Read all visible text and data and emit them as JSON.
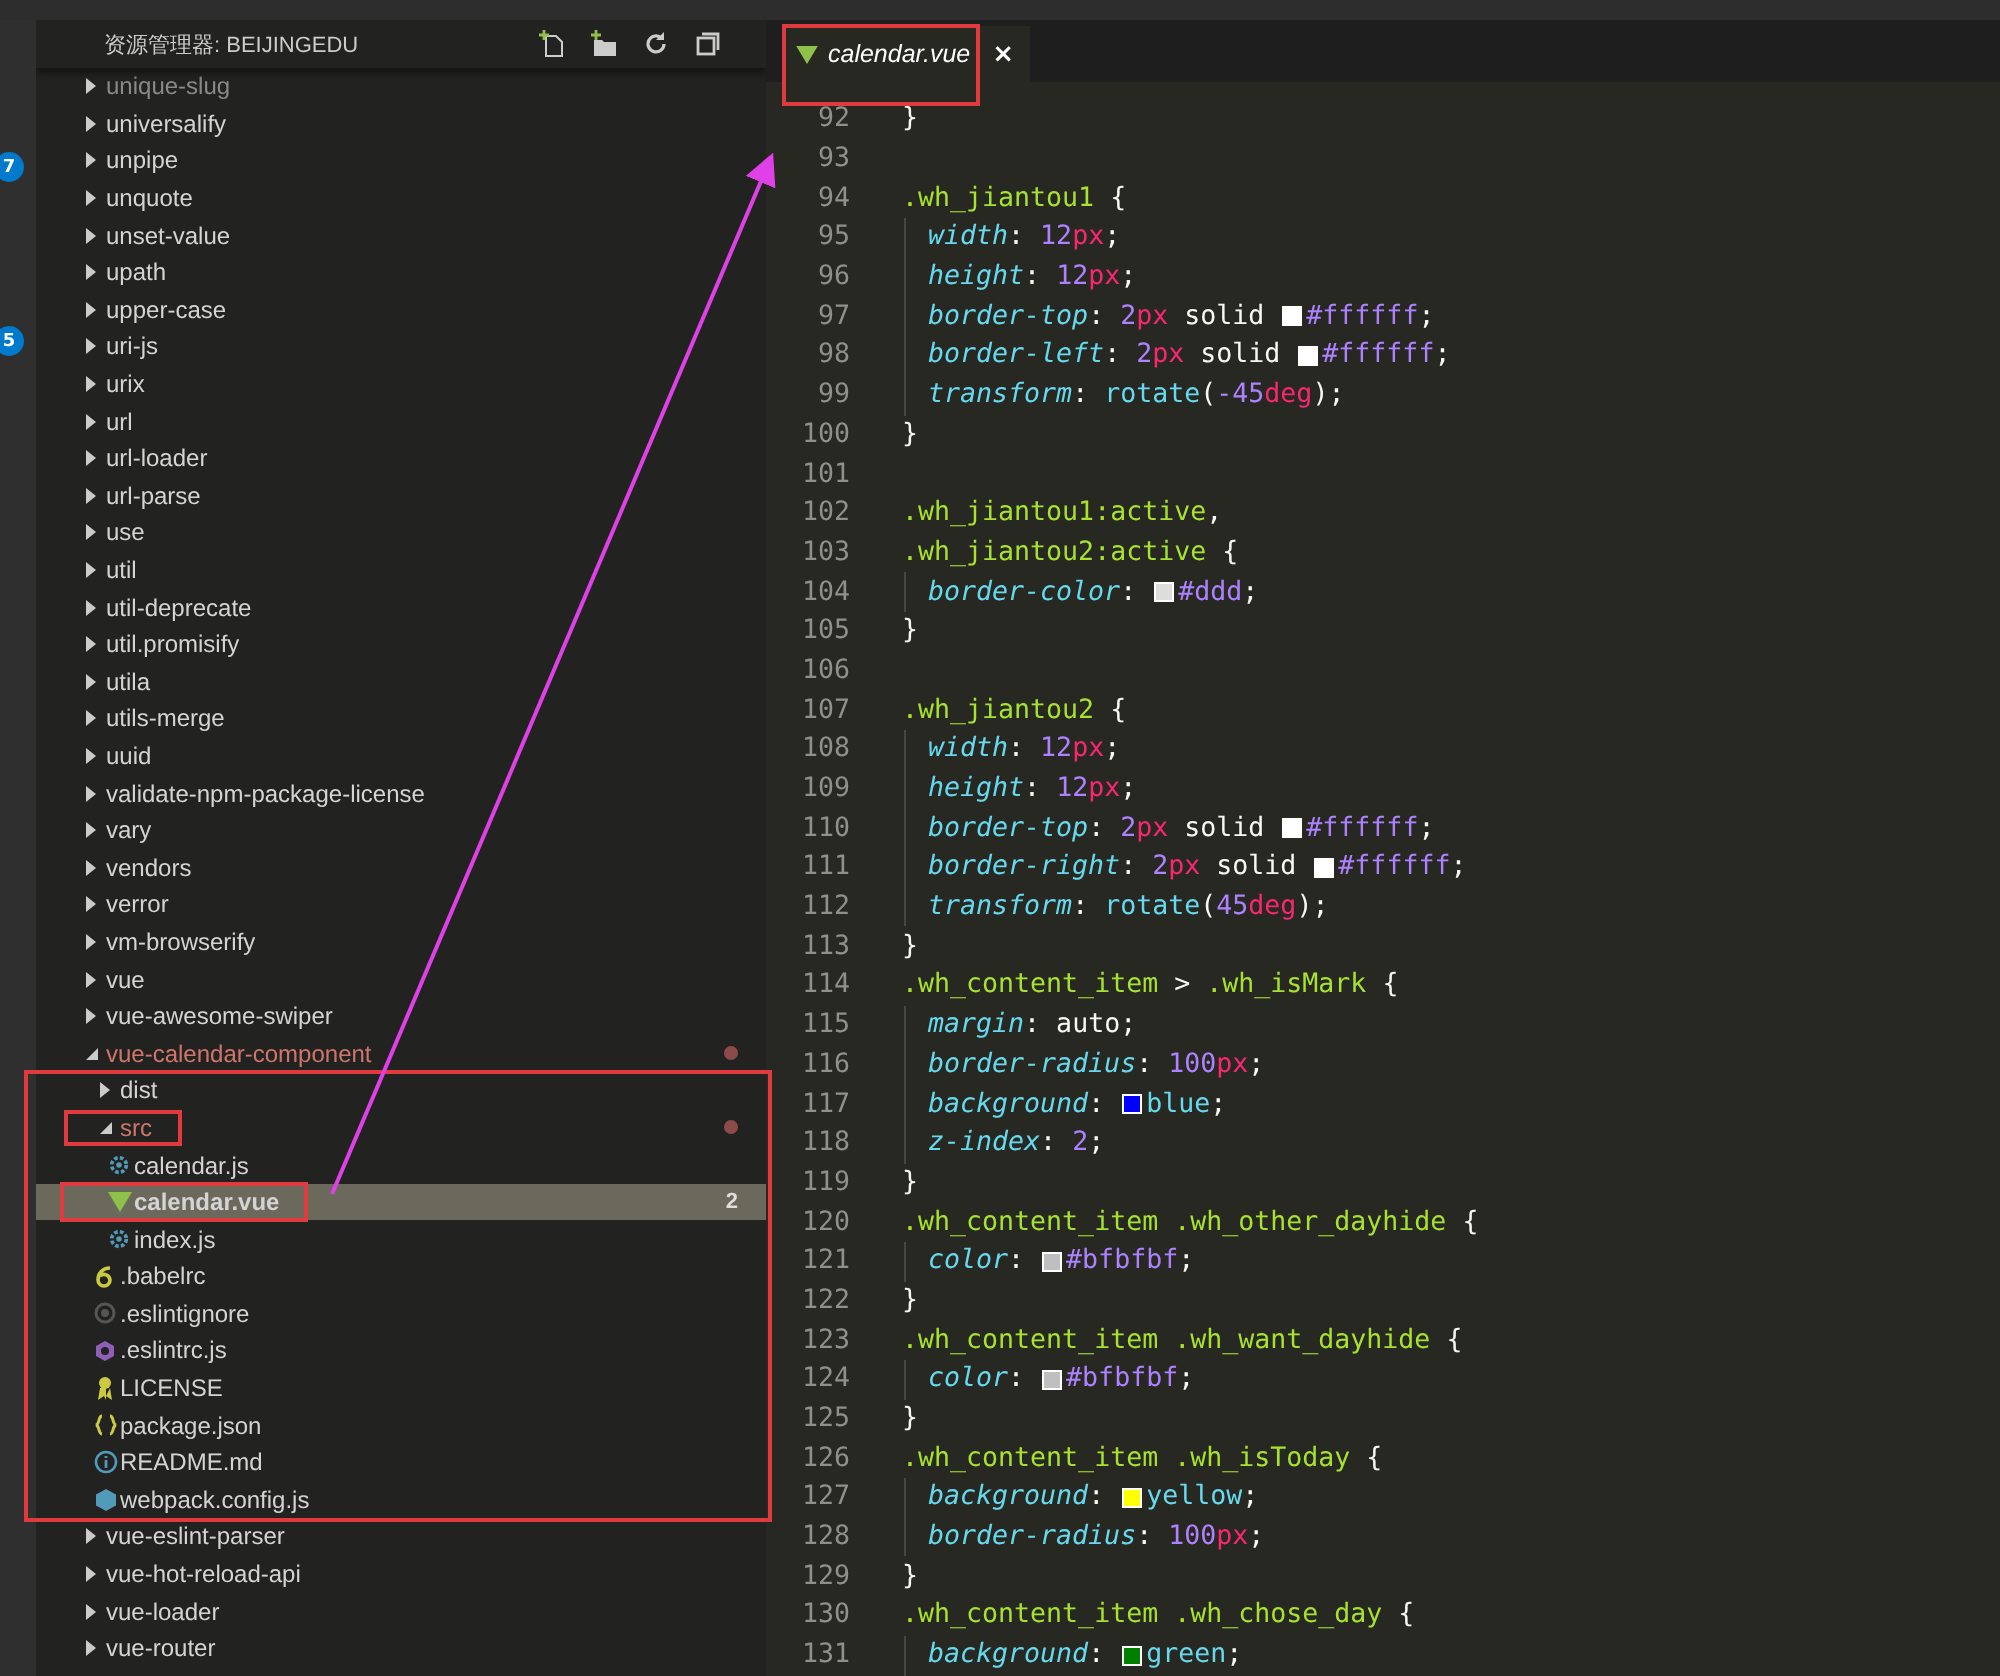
{
  "activity_bar": {
    "badges": [
      "7",
      "5"
    ]
  },
  "explorer": {
    "title": "资源管理器: BEIJINGEDU",
    "tree": [
      {
        "label": "unique-slug",
        "kind": "folder",
        "expanded": false,
        "selected": false,
        "modified": false,
        "faded": true
      },
      {
        "label": "universalify",
        "kind": "folder",
        "expanded": false,
        "selected": false,
        "modified": false,
        "faded": false
      },
      {
        "label": "unpipe",
        "kind": "folder",
        "expanded": false,
        "selected": false,
        "modified": false,
        "faded": false
      },
      {
        "label": "unquote",
        "kind": "folder",
        "expanded": false,
        "selected": false,
        "modified": false,
        "faded": false
      },
      {
        "label": "unset-value",
        "kind": "folder",
        "expanded": false,
        "selected": false,
        "modified": false,
        "faded": false
      },
      {
        "label": "upath",
        "kind": "folder",
        "expanded": false,
        "selected": false,
        "modified": false,
        "faded": false
      },
      {
        "label": "upper-case",
        "kind": "folder",
        "expanded": false,
        "selected": false,
        "modified": false,
        "faded": false
      },
      {
        "label": "uri-js",
        "kind": "folder",
        "expanded": false,
        "selected": false,
        "modified": false,
        "faded": false
      },
      {
        "label": "urix",
        "kind": "folder",
        "expanded": false,
        "selected": false,
        "modified": false,
        "faded": false
      },
      {
        "label": "url",
        "kind": "folder",
        "expanded": false,
        "selected": false,
        "modified": false,
        "faded": false
      },
      {
        "label": "url-loader",
        "kind": "folder",
        "expanded": false,
        "selected": false,
        "modified": false,
        "faded": false
      },
      {
        "label": "url-parse",
        "kind": "folder",
        "expanded": false,
        "selected": false,
        "modified": false,
        "faded": false
      },
      {
        "label": "use",
        "kind": "folder",
        "expanded": false,
        "selected": false,
        "modified": false,
        "faded": false
      },
      {
        "label": "util",
        "kind": "folder",
        "expanded": false,
        "selected": false,
        "modified": false,
        "faded": false
      },
      {
        "label": "util-deprecate",
        "kind": "folder",
        "expanded": false,
        "selected": false,
        "modified": false,
        "faded": false
      },
      {
        "label": "util.promisify",
        "kind": "folder",
        "expanded": false,
        "selected": false,
        "modified": false,
        "faded": false
      },
      {
        "label": "utila",
        "kind": "folder",
        "expanded": false,
        "selected": false,
        "modified": false,
        "faded": false
      },
      {
        "label": "utils-merge",
        "kind": "folder",
        "expanded": false,
        "selected": false,
        "modified": false,
        "faded": false
      },
      {
        "label": "uuid",
        "kind": "folder",
        "expanded": false,
        "selected": false,
        "modified": false,
        "faded": false
      },
      {
        "label": "validate-npm-package-license",
        "kind": "folder",
        "expanded": false,
        "selected": false,
        "modified": false,
        "faded": false
      },
      {
        "label": "vary",
        "kind": "folder",
        "expanded": false,
        "selected": false,
        "modified": false,
        "faded": false
      },
      {
        "label": "vendors",
        "kind": "folder",
        "expanded": false,
        "selected": false,
        "modified": false,
        "faded": false
      },
      {
        "label": "verror",
        "kind": "folder",
        "expanded": false,
        "selected": false,
        "modified": false,
        "faded": false
      },
      {
        "label": "vm-browserify",
        "kind": "folder",
        "expanded": false,
        "selected": false,
        "modified": false,
        "faded": false
      },
      {
        "label": "vue",
        "kind": "folder",
        "expanded": false,
        "selected": false,
        "modified": false,
        "faded": false
      },
      {
        "label": "vue-awesome-swiper",
        "kind": "folder",
        "expanded": false,
        "selected": false,
        "modified": false,
        "faded": false
      },
      {
        "label": "vue-calendar-component",
        "kind": "folder",
        "expanded": true,
        "selected": false,
        "modified": true,
        "faded": false,
        "children": [
          {
            "label": "dist",
            "kind": "folder",
            "expanded": false,
            "selected": false,
            "modified": false,
            "faded": false
          },
          {
            "label": "src",
            "kind": "folder",
            "expanded": true,
            "selected": false,
            "modified": true,
            "faded": false,
            "children": [
              {
                "label": "calendar.js",
                "kind": "js",
                "selected": false,
                "modified": false,
                "faded": false
              },
              {
                "label": "calendar.vue",
                "kind": "vue",
                "selected": true,
                "modified": false,
                "faded": false,
                "badge": "2"
              },
              {
                "label": "index.js",
                "kind": "js",
                "selected": false,
                "modified": false,
                "faded": false
              }
            ]
          },
          {
            "label": ".babelrc",
            "kind": "babel",
            "selected": false,
            "modified": false,
            "faded": false
          },
          {
            "label": ".eslintignore",
            "kind": "ignore",
            "selected": false,
            "modified": false,
            "faded": false
          },
          {
            "label": ".eslintrc.js",
            "kind": "eslint",
            "selected": false,
            "modified": false,
            "faded": false
          },
          {
            "label": "LICENSE",
            "kind": "license",
            "selected": false,
            "modified": false,
            "faded": false
          },
          {
            "label": "package.json",
            "kind": "json",
            "selected": false,
            "modified": false,
            "faded": false
          },
          {
            "label": "README.md",
            "kind": "info",
            "selected": false,
            "modified": false,
            "faded": false
          },
          {
            "label": "webpack.config.js",
            "kind": "webpack",
            "selected": false,
            "modified": false,
            "faded": false
          }
        ]
      },
      {
        "label": "vue-eslint-parser",
        "kind": "folder",
        "expanded": false,
        "selected": false,
        "modified": false,
        "faded": false
      },
      {
        "label": "vue-hot-reload-api",
        "kind": "folder",
        "expanded": false,
        "selected": false,
        "modified": false,
        "faded": false
      },
      {
        "label": "vue-loader",
        "kind": "folder",
        "expanded": false,
        "selected": false,
        "modified": false,
        "faded": false
      },
      {
        "label": "vue-router",
        "kind": "folder",
        "expanded": false,
        "selected": false,
        "modified": false,
        "faded": false
      }
    ]
  },
  "editor": {
    "tabs": [
      {
        "label": "calendar.vue",
        "close": "×",
        "selected": true
      }
    ],
    "lines": [
      {
        "number": "92",
        "indented": false,
        "tokens": [
          {
            "kind": "punct",
            "text": "}"
          }
        ]
      },
      {
        "number": "93",
        "indented": false
      },
      {
        "number": "94",
        "indented": false,
        "tokens": [
          {
            "kind": "selector",
            "text": ".wh_jiantou1"
          },
          {
            "kind": "punct",
            "text": " {"
          }
        ]
      },
      {
        "number": "95",
        "indented": true,
        "tokens": [
          {
            "kind": "prop",
            "text": "width"
          },
          {
            "kind": "punct",
            "text": ": "
          },
          {
            "kind": "num",
            "text": "12"
          },
          {
            "kind": "unit",
            "text": "px"
          },
          {
            "kind": "punct",
            "text": ";"
          }
        ]
      },
      {
        "number": "96",
        "indented": true,
        "tokens": [
          {
            "kind": "prop",
            "text": "height"
          },
          {
            "kind": "punct",
            "text": ": "
          },
          {
            "kind": "num",
            "text": "12"
          },
          {
            "kind": "unit",
            "text": "px"
          },
          {
            "kind": "punct",
            "text": ";"
          }
        ]
      },
      {
        "number": "97",
        "indented": true,
        "tokens": [
          {
            "kind": "prop",
            "text": "border-top"
          },
          {
            "kind": "punct",
            "text": ": "
          },
          {
            "kind": "num",
            "text": "2"
          },
          {
            "kind": "unit",
            "text": "px"
          },
          {
            "kind": "punct",
            "text": " solid "
          },
          {
            "kind": "swatch",
            "color": "#ffffff"
          },
          {
            "kind": "num",
            "text": "#ffffff"
          },
          {
            "kind": "punct",
            "text": ";"
          }
        ]
      },
      {
        "number": "98",
        "indented": true,
        "tokens": [
          {
            "kind": "prop",
            "text": "border-left"
          },
          {
            "kind": "punct",
            "text": ": "
          },
          {
            "kind": "num",
            "text": "2"
          },
          {
            "kind": "unit",
            "text": "px"
          },
          {
            "kind": "punct",
            "text": " solid "
          },
          {
            "kind": "swatch",
            "color": "#ffffff"
          },
          {
            "kind": "num",
            "text": "#ffffff"
          },
          {
            "kind": "punct",
            "text": ";"
          }
        ]
      },
      {
        "number": "99",
        "indented": true,
        "tokens": [
          {
            "kind": "prop",
            "text": "transform"
          },
          {
            "kind": "punct",
            "text": ": "
          },
          {
            "kind": "func",
            "text": "rotate"
          },
          {
            "kind": "punct",
            "text": "("
          },
          {
            "kind": "num",
            "text": "-45"
          },
          {
            "kind": "unit",
            "text": "deg"
          },
          {
            "kind": "punct",
            "text": ");"
          }
        ]
      },
      {
        "number": "100",
        "indented": false,
        "tokens": [
          {
            "kind": "punct",
            "text": "}"
          }
        ]
      },
      {
        "number": "101",
        "indented": false
      },
      {
        "number": "102",
        "indented": false,
        "tokens": [
          {
            "kind": "selector",
            "text": ".wh_jiantou1:active"
          },
          {
            "kind": "punct",
            "text": ","
          }
        ]
      },
      {
        "number": "103",
        "indented": false,
        "tokens": [
          {
            "kind": "selector",
            "text": ".wh_jiantou2:active"
          },
          {
            "kind": "punct",
            "text": " {"
          }
        ]
      },
      {
        "number": "104",
        "indented": true,
        "tokens": [
          {
            "kind": "prop",
            "text": "border-color"
          },
          {
            "kind": "punct",
            "text": ": "
          },
          {
            "kind": "swatch",
            "color": "#dddddd"
          },
          {
            "kind": "num",
            "text": "#ddd"
          },
          {
            "kind": "punct",
            "text": ";"
          }
        ]
      },
      {
        "number": "105",
        "indented": false,
        "tokens": [
          {
            "kind": "punct",
            "text": "}"
          }
        ]
      },
      {
        "number": "106",
        "indented": false
      },
      {
        "number": "107",
        "indented": false,
        "tokens": [
          {
            "kind": "selector",
            "text": ".wh_jiantou2"
          },
          {
            "kind": "punct",
            "text": " {"
          }
        ]
      },
      {
        "number": "108",
        "indented": true,
        "tokens": [
          {
            "kind": "prop",
            "text": "width"
          },
          {
            "kind": "punct",
            "text": ": "
          },
          {
            "kind": "num",
            "text": "12"
          },
          {
            "kind": "unit",
            "text": "px"
          },
          {
            "kind": "punct",
            "text": ";"
          }
        ]
      },
      {
        "number": "109",
        "indented": true,
        "tokens": [
          {
            "kind": "prop",
            "text": "height"
          },
          {
            "kind": "punct",
            "text": ": "
          },
          {
            "kind": "num",
            "text": "12"
          },
          {
            "kind": "unit",
            "text": "px"
          },
          {
            "kind": "punct",
            "text": ";"
          }
        ]
      },
      {
        "number": "110",
        "indented": true,
        "tokens": [
          {
            "kind": "prop",
            "text": "border-top"
          },
          {
            "kind": "punct",
            "text": ": "
          },
          {
            "kind": "num",
            "text": "2"
          },
          {
            "kind": "unit",
            "text": "px"
          },
          {
            "kind": "punct",
            "text": " solid "
          },
          {
            "kind": "swatch",
            "color": "#ffffff"
          },
          {
            "kind": "num",
            "text": "#ffffff"
          },
          {
            "kind": "punct",
            "text": ";"
          }
        ]
      },
      {
        "number": "111",
        "indented": true,
        "tokens": [
          {
            "kind": "prop",
            "text": "border-right"
          },
          {
            "kind": "punct",
            "text": ": "
          },
          {
            "kind": "num",
            "text": "2"
          },
          {
            "kind": "unit",
            "text": "px"
          },
          {
            "kind": "punct",
            "text": " solid "
          },
          {
            "kind": "swatch",
            "color": "#ffffff"
          },
          {
            "kind": "num",
            "text": "#ffffff"
          },
          {
            "kind": "punct",
            "text": ";"
          }
        ]
      },
      {
        "number": "112",
        "indented": true,
        "tokens": [
          {
            "kind": "prop",
            "text": "transform"
          },
          {
            "kind": "punct",
            "text": ": "
          },
          {
            "kind": "func",
            "text": "rotate"
          },
          {
            "kind": "punct",
            "text": "("
          },
          {
            "kind": "num",
            "text": "45"
          },
          {
            "kind": "unit",
            "text": "deg"
          },
          {
            "kind": "punct",
            "text": ");"
          }
        ]
      },
      {
        "number": "113",
        "indented": false,
        "tokens": [
          {
            "kind": "punct",
            "text": "}"
          }
        ]
      },
      {
        "number": "114",
        "indented": false,
        "tokens": [
          {
            "kind": "selector",
            "text": ".wh_content_item"
          },
          {
            "kind": "punct",
            "text": " > "
          },
          {
            "kind": "selector",
            "text": ".wh_isMark"
          },
          {
            "kind": "punct",
            "text": " {"
          }
        ]
      },
      {
        "number": "115",
        "indented": true,
        "tokens": [
          {
            "kind": "prop",
            "text": "margin"
          },
          {
            "kind": "punct",
            "text": ": auto;"
          }
        ]
      },
      {
        "number": "116",
        "indented": true,
        "tokens": [
          {
            "kind": "prop",
            "text": "border-radius"
          },
          {
            "kind": "punct",
            "text": ": "
          },
          {
            "kind": "num",
            "text": "100"
          },
          {
            "kind": "unit",
            "text": "px"
          },
          {
            "kind": "punct",
            "text": ";"
          }
        ]
      },
      {
        "number": "117",
        "indented": true,
        "tokens": [
          {
            "kind": "prop",
            "text": "background"
          },
          {
            "kind": "punct",
            "text": ": "
          },
          {
            "kind": "swatch",
            "color": "#0000ff"
          },
          {
            "kind": "func",
            "text": "blue"
          },
          {
            "kind": "punct",
            "text": ";"
          }
        ]
      },
      {
        "number": "118",
        "indented": true,
        "tokens": [
          {
            "kind": "prop",
            "text": "z-index"
          },
          {
            "kind": "punct",
            "text": ": "
          },
          {
            "kind": "num",
            "text": "2"
          },
          {
            "kind": "punct",
            "text": ";"
          }
        ]
      },
      {
        "number": "119",
        "indented": false,
        "tokens": [
          {
            "kind": "punct",
            "text": "}"
          }
        ]
      },
      {
        "number": "120",
        "indented": false,
        "tokens": [
          {
            "kind": "selector",
            "text": ".wh_content_item .wh_other_dayhide"
          },
          {
            "kind": "punct",
            "text": " {"
          }
        ]
      },
      {
        "number": "121",
        "indented": true,
        "tokens": [
          {
            "kind": "prop",
            "text": "color"
          },
          {
            "kind": "punct",
            "text": ": "
          },
          {
            "kind": "swatch",
            "color": "#bfbfbf"
          },
          {
            "kind": "num",
            "text": "#bfbfbf"
          },
          {
            "kind": "punct",
            "text": ";"
          }
        ]
      },
      {
        "number": "122",
        "indented": false,
        "tokens": [
          {
            "kind": "punct",
            "text": "}"
          }
        ]
      },
      {
        "number": "123",
        "indented": false,
        "tokens": [
          {
            "kind": "selector",
            "text": ".wh_content_item .wh_want_dayhide"
          },
          {
            "kind": "punct",
            "text": " {"
          }
        ]
      },
      {
        "number": "124",
        "indented": true,
        "tokens": [
          {
            "kind": "prop",
            "text": "color"
          },
          {
            "kind": "punct",
            "text": ": "
          },
          {
            "kind": "swatch",
            "color": "#bfbfbf"
          },
          {
            "kind": "num",
            "text": "#bfbfbf"
          },
          {
            "kind": "punct",
            "text": ";"
          }
        ]
      },
      {
        "number": "125",
        "indented": false,
        "tokens": [
          {
            "kind": "punct",
            "text": "}"
          }
        ]
      },
      {
        "number": "126",
        "indented": false,
        "tokens": [
          {
            "kind": "selector",
            "text": ".wh_content_item .wh_isToday"
          },
          {
            "kind": "punct",
            "text": " {"
          }
        ]
      },
      {
        "number": "127",
        "indented": true,
        "tokens": [
          {
            "kind": "prop",
            "text": "background"
          },
          {
            "kind": "punct",
            "text": ": "
          },
          {
            "kind": "swatch",
            "color": "#ffff00"
          },
          {
            "kind": "func",
            "text": "yellow"
          },
          {
            "kind": "punct",
            "text": ";"
          }
        ]
      },
      {
        "number": "128",
        "indented": true,
        "tokens": [
          {
            "kind": "prop",
            "text": "border-radius"
          },
          {
            "kind": "punct",
            "text": ": "
          },
          {
            "kind": "num",
            "text": "100"
          },
          {
            "kind": "unit",
            "text": "px"
          },
          {
            "kind": "punct",
            "text": ";"
          }
        ]
      },
      {
        "number": "129",
        "indented": false,
        "tokens": [
          {
            "kind": "punct",
            "text": "}"
          }
        ]
      },
      {
        "number": "130",
        "indented": false,
        "tokens": [
          {
            "kind": "selector",
            "text": ".wh_content_item .wh_chose_day"
          },
          {
            "kind": "punct",
            "text": " {"
          }
        ]
      },
      {
        "number": "131",
        "indented": true,
        "tokens": [
          {
            "kind": "prop",
            "text": "background"
          },
          {
            "kind": "punct",
            "text": ": "
          },
          {
            "kind": "swatch",
            "color": "#008000"
          },
          {
            "kind": "func",
            "text": "green"
          },
          {
            "kind": "punct",
            "text": ";"
          }
        ]
      }
    ]
  }
}
